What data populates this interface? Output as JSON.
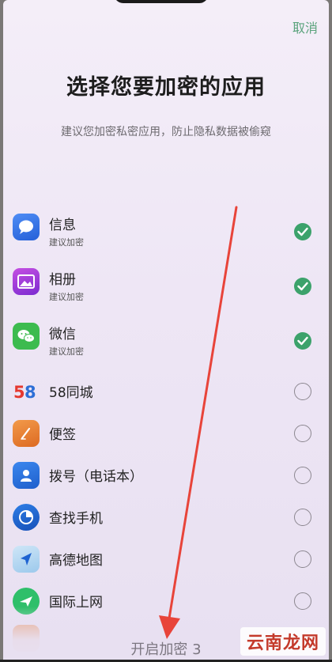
{
  "header": {
    "cancel_label": "取消",
    "title": "选择您要加密的应用",
    "subtitle": "建议您加密私密应用，防止隐私数据被偷窥"
  },
  "apps": [
    {
      "name": "信息",
      "hint": "建议加密",
      "icon": "message-icon",
      "selected": true
    },
    {
      "name": "相册",
      "hint": "建议加密",
      "icon": "gallery-icon",
      "selected": true
    },
    {
      "name": "微信",
      "hint": "建议加密",
      "icon": "wechat-icon",
      "selected": true
    },
    {
      "name": "58同城",
      "hint": "",
      "icon": "58-logo-icon",
      "selected": false
    },
    {
      "name": "便签",
      "hint": "",
      "icon": "note-icon",
      "selected": false
    },
    {
      "name": "拨号（电话本）",
      "hint": "",
      "icon": "contacts-icon",
      "selected": false
    },
    {
      "name": "查找手机",
      "hint": "",
      "icon": "find-phone-icon",
      "selected": false
    },
    {
      "name": "高德地图",
      "hint": "",
      "icon": "map-icon",
      "selected": false
    },
    {
      "name": "国际上网",
      "hint": "",
      "icon": "airplane-icon",
      "selected": false
    }
  ],
  "footer": {
    "enable_label": "开启加密 3"
  },
  "watermark": "云南龙网",
  "colors": {
    "accent_green": "#3ca26b",
    "arrow_red": "#e8443a"
  }
}
